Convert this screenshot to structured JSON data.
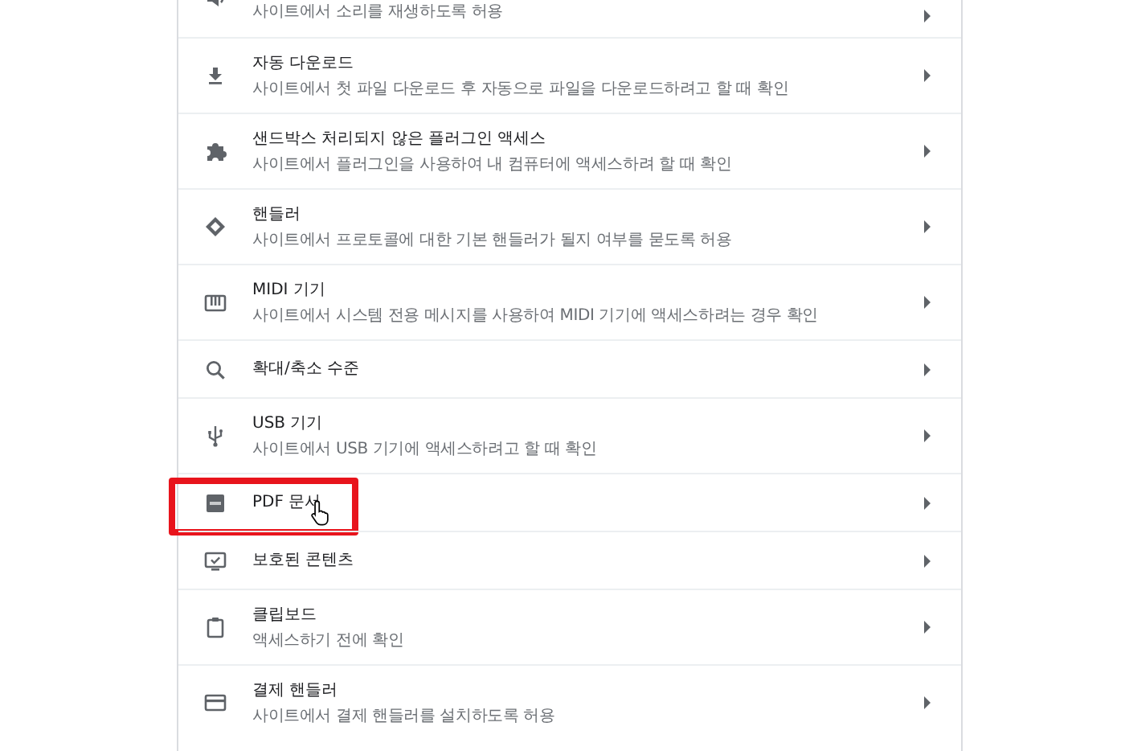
{
  "rows": [
    {
      "kind": "sound",
      "subtitle": "사이트에서 소리를 재생하도록 허용",
      "highlighted": false,
      "cursor": false
    },
    {
      "kind": "download",
      "title": "자동 다운로드",
      "subtitle": "사이트에서 첫 파일 다운로드 후 자동으로 파일을 다운로드하려고 할 때 확인",
      "highlighted": false,
      "cursor": false
    },
    {
      "kind": "plugin",
      "title": "샌드박스 처리되지 않은 플러그인 액세스",
      "subtitle": "사이트에서 플러그인을 사용하여 내 컴퓨터에 액세스하려 할 때 확인",
      "highlighted": false,
      "cursor": false
    },
    {
      "kind": "handler",
      "title": "핸들러",
      "subtitle": "사이트에서 프로토콜에 대한 기본 핸들러가 될지 여부를 묻도록 허용",
      "highlighted": false,
      "cursor": false
    },
    {
      "kind": "midi",
      "title": "MIDI 기기",
      "subtitle": "사이트에서 시스템 전용 메시지를 사용하여 MIDI 기기에 액세스하려는 경우 확인",
      "highlighted": false,
      "cursor": false
    },
    {
      "kind": "zoom",
      "title": "확대/축소 수준",
      "highlighted": false,
      "cursor": false
    },
    {
      "kind": "usb",
      "title": "USB 기기",
      "subtitle": "사이트에서 USB 기기에 액세스하려고 할 때 확인",
      "highlighted": false,
      "cursor": false
    },
    {
      "kind": "pdf",
      "title": "PDF 문서",
      "highlighted": true,
      "cursor": true
    },
    {
      "kind": "protected",
      "title": "보호된 콘텐츠",
      "highlighted": false,
      "cursor": false
    },
    {
      "kind": "clipboard",
      "title": "클립보드",
      "subtitle": "액세스하기 전에 확인",
      "highlighted": false,
      "cursor": false
    },
    {
      "kind": "payment",
      "title": "결제 핸들러",
      "subtitle": "사이트에서 결제 핸들러를 설치하도록 허용",
      "highlighted": false,
      "cursor": false
    }
  ]
}
